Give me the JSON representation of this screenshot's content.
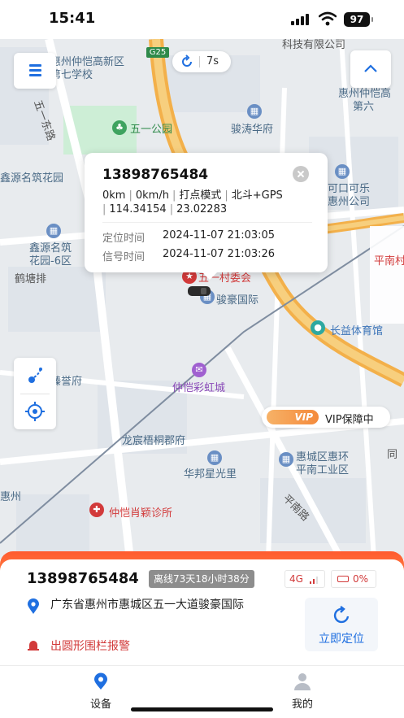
{
  "status_bar": {
    "time": "15:41",
    "battery": "97"
  },
  "map": {
    "refresh_interval": "7s",
    "road_badge": "G25",
    "labels": [
      {
        "text": "科技有限公司"
      },
      {
        "text": "惠州仲恺高新区"
      },
      {
        "text": "第七学校"
      },
      {
        "text": "五一东路"
      },
      {
        "text": "五一公园"
      },
      {
        "text": "骏涛华府"
      },
      {
        "text": "惠州仲恺高"
      },
      {
        "text": "第六"
      },
      {
        "text": "鑫源名筑花园"
      },
      {
        "text": "可口可乐"
      },
      {
        "text": "惠州公司"
      },
      {
        "text": "鑫源名筑"
      },
      {
        "text": "花园-6区"
      },
      {
        "text": "鹤塘排"
      },
      {
        "text": "五一村委会"
      },
      {
        "text": "骏豪国际"
      },
      {
        "text": "平南村"
      },
      {
        "text": "长益体育馆"
      },
      {
        "text": "臻誉府"
      },
      {
        "text": "仲恺彩虹城"
      },
      {
        "text": "龙宸梧桐郡府"
      },
      {
        "text": "惠城区惠环"
      },
      {
        "text": "平南工业区"
      },
      {
        "text": "华邦星光里"
      },
      {
        "text": "仲恺肖颖诊所"
      },
      {
        "text": "平南路"
      },
      {
        "text": "惠州"
      },
      {
        "text": "同"
      }
    ]
  },
  "popup": {
    "phone": "13898765484",
    "speed_mileage": "0km",
    "speed": "0km/h",
    "mode": "打点模式",
    "positioning": "北斗+GPS",
    "longitude": "114.34154",
    "latitude": "23.02283",
    "locate_time_label": "定位时间",
    "locate_time": "2024-11-07 21:03:05",
    "signal_time_label": "信号时间",
    "signal_time": "2024-11-07 21:03:26"
  },
  "vip": {
    "badge": "VIP",
    "text": "VIP保障中"
  },
  "device": {
    "phone": "13898765484",
    "offline": "离线73天18小时38分",
    "network": "4G",
    "battery": "0%",
    "address": "广东省惠州市惠城区五一大道骏豪国际",
    "alarm": "出圆形围栏报警",
    "locate_button": "立即定位"
  },
  "tabs": [
    {
      "label": "设备"
    },
    {
      "label": "我的"
    }
  ],
  "colors": {
    "accent": "#1f6fe0",
    "alarm": "#d23a3a",
    "sheet_gradient": "#ff5a2e"
  }
}
